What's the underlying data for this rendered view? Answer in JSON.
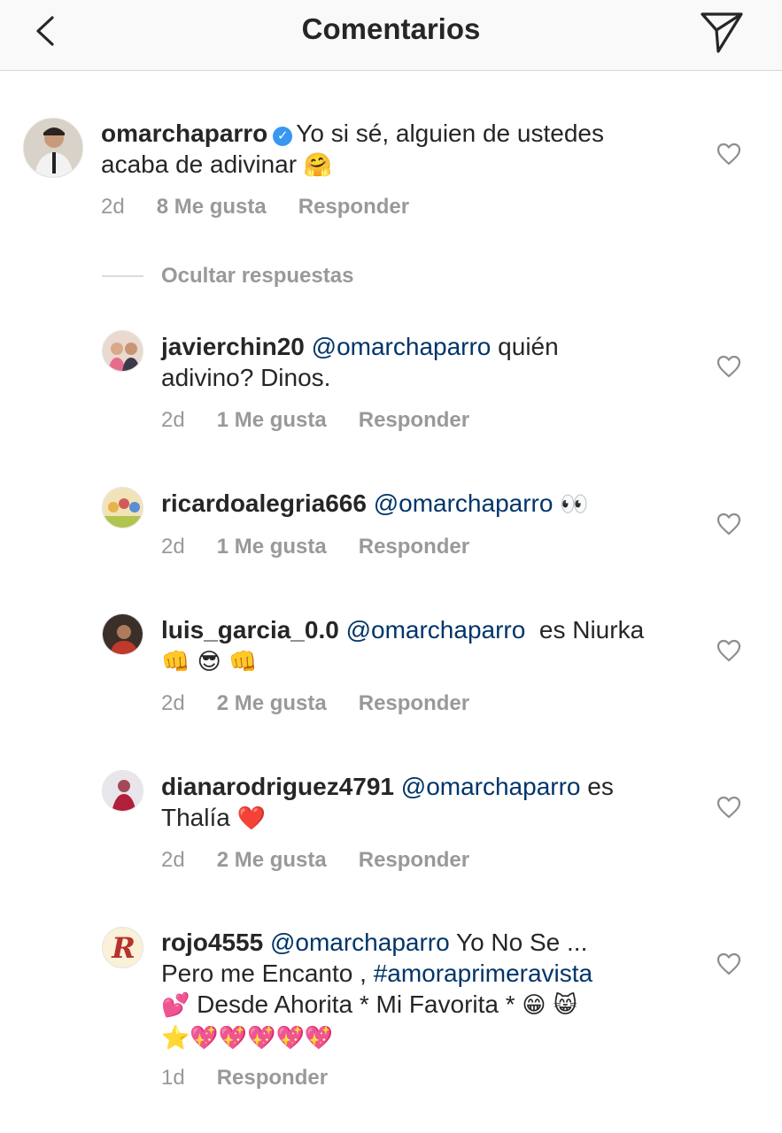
{
  "header": {
    "title": "Comentarios",
    "back_icon": "chevron-left-icon",
    "share_icon": "paper-plane-icon"
  },
  "main_comment": {
    "username": "omarchaparro",
    "verified": true,
    "text_line1": "Yo si sé, alguien de ustedes",
    "text_line2": "acaba de adivinar",
    "emoji": "🤗",
    "time": "2d",
    "likes": "8 Me gusta",
    "reply": "Responder"
  },
  "hide_replies": "Ocultar respuestas",
  "replies": [
    {
      "username": "javierchin20",
      "mention": "@omarchaparro",
      "text_a": " quién",
      "text_b": "adivino? Dinos.",
      "time": "2d",
      "likes": "1 Me gusta",
      "reply": "Responder"
    },
    {
      "username": "ricardoalegria666",
      "mention": "@omarchaparro",
      "emoji": "👀",
      "time": "2d",
      "likes": "1 Me gusta",
      "reply": "Responder"
    },
    {
      "username": "luis_garcia_0.0",
      "mention": "@omarchaparro",
      "text_a": "  es Niurka",
      "emoji_line": "👊 😎 👊",
      "time": "2d",
      "likes": "2 Me gusta",
      "reply": "Responder"
    },
    {
      "username": "dianarodriguez4791",
      "mention": "@omarchaparro",
      "text_a": " es",
      "text_b": "Thalía",
      "emoji": "❤️",
      "time": "2d",
      "likes": "2 Me gusta",
      "reply": "Responder"
    },
    {
      "username": "rojo4555",
      "mention": "@omarchaparro",
      "text_a": " Yo No Se ...",
      "text_b": "Pero me Encanto , ",
      "hashtag": "#amoraprimeravista",
      "text_c_emoji": "💕",
      "text_c": " Desde Ahorita * Mi Favorita * ",
      "text_c_end_emoji": "😁 😸",
      "emoji_line": "⭐💖💖💖💖💖",
      "time": "1d",
      "reply": "Responder"
    }
  ],
  "colors": {
    "mention": "#003569",
    "meta_gray": "#999999",
    "verified_blue": "#3897f0"
  }
}
